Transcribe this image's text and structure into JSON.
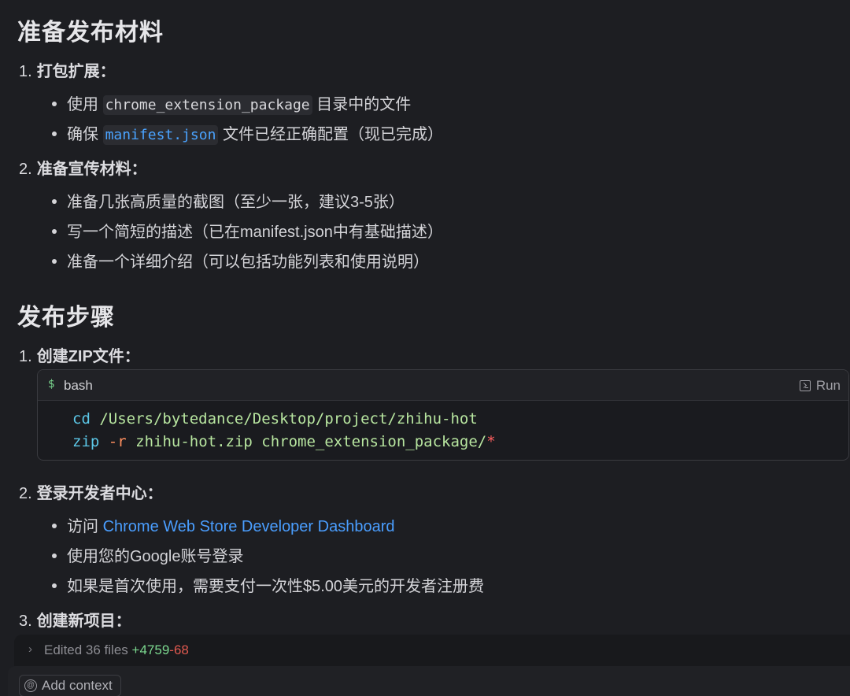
{
  "sections": {
    "prepare": {
      "title": "准备发布材料",
      "step1": {
        "num": "1.",
        "label": "打包扩展：",
        "item1_prefix": "使用",
        "item1_code": "chrome_extension_package",
        "item1_suffix": "目录中的文件",
        "item2_prefix": "确保",
        "item2_code": "manifest.json",
        "item2_suffix": "文件已经正确配置（现已完成）"
      },
      "step2": {
        "num": "2.",
        "label": "准备宣传材料：",
        "items": [
          "准备几张高质量的截图（至少一张，建议3-5张）",
          "写一个简短的描述（已在manifest.json中有基础描述）",
          "准备一个详细介绍（可以包括功能列表和使用说明）"
        ]
      }
    },
    "publish": {
      "title": "发布步骤",
      "step1": {
        "num": "1.",
        "label": "创建ZIP文件："
      },
      "step2": {
        "num": "2.",
        "label": "登录开发者中心：",
        "item1_prefix": "访问",
        "item1_link": "Chrome Web Store Developer Dashboard",
        "item2": "使用您的Google账号登录",
        "item3": "如果是首次使用，需要支付一次性$5.00美元的开发者注册费"
      },
      "step3": {
        "num": "3.",
        "label": "创建新项目："
      }
    }
  },
  "codeblock": {
    "prompt_symbol": "$",
    "language": "bash",
    "run_label": "Run",
    "line1_cmd": "cd",
    "line1_arg": "/Users/bytedance/Desktop/project/zhihu-hot",
    "line2_cmd": "zip",
    "line2_flag": "-r",
    "line2_arg": "zhihu-hot.zip chrome_extension_package/",
    "line2_star": "*"
  },
  "edited_bar": {
    "text": "Edited 36 files",
    "additions": "+4759",
    "deletions": "-68"
  },
  "composer": {
    "add_context_label": "Add context"
  },
  "colors": {
    "background": "#1d1e22",
    "link": "#4a9eff",
    "additions": "#7bd88f",
    "deletions": "#e0594f"
  }
}
